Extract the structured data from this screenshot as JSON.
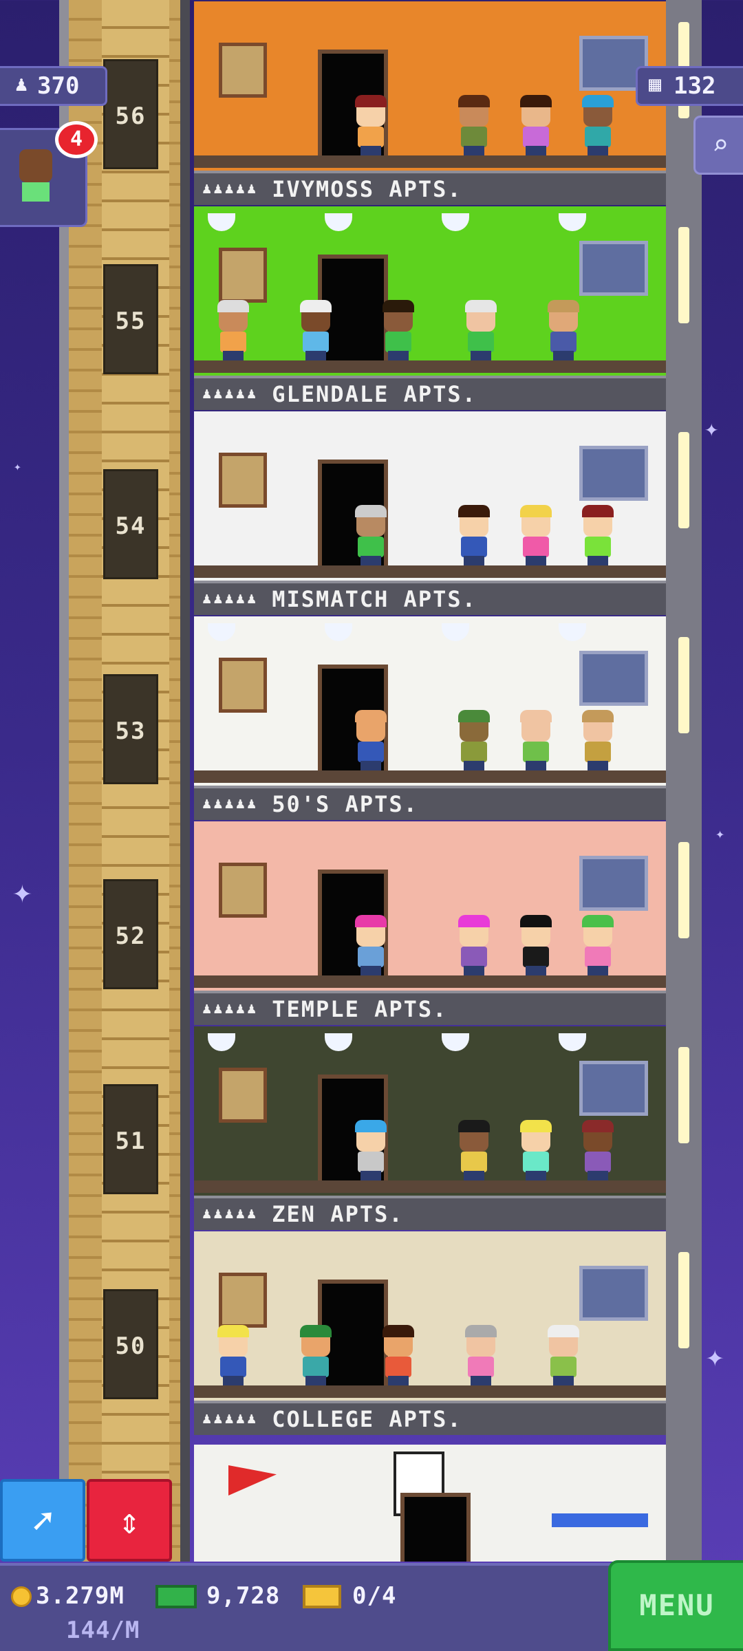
{
  "hud": {
    "population": "370",
    "floors_count": "132",
    "visitor_badge": "4",
    "icons": {
      "population": "person-icon",
      "floors": "building-icon",
      "search": "magnifier-icon"
    }
  },
  "floors": [
    {
      "number": "56",
      "name": "IVYMOSS APTS.",
      "wall": "#e8862a",
      "residents": [
        {
          "skin": "#f6d1a9",
          "hair": "#8a1f1f",
          "shirt": "#f1a24a"
        },
        {
          "skin": "#c98a5a",
          "hair": "#5a2a12",
          "shirt": "#6e8a3a"
        },
        {
          "skin": "#e9b78a",
          "hair": "#3a1a0a",
          "shirt": "#c86ad8"
        },
        {
          "skin": "#8a5a3a",
          "hair": "#2aa0d8",
          "shirt": "#30a8a8"
        }
      ]
    },
    {
      "number": "55",
      "name": "GLENDALE APTS.",
      "wall": "#5ed21e",
      "residents": [
        {
          "skin": "#c98a5a",
          "hair": "#ddd",
          "shirt": "#f1a24a"
        },
        {
          "skin": "#7a4a2a",
          "hair": "#eee",
          "shirt": "#5fb8e8"
        },
        {
          "skin": "#8a5a3a",
          "hair": "#2a1a0a",
          "shirt": "#3fc04a"
        },
        {
          "skin": "#f0c4a2",
          "hair": "#e6e6e6",
          "shirt": "#3fc04a"
        },
        {
          "skin": "#e0a878",
          "hair": "#c49a5a",
          "shirt": "#4a5aa8"
        }
      ]
    },
    {
      "number": "54",
      "name": "MISMATCH APTS.",
      "wall": "#f2f2f2",
      "residents": [
        {
          "skin": "#b88a62",
          "hair": "#ccc",
          "shirt": "#3fc04a"
        },
        {
          "skin": "#f6d1a9",
          "hair": "#3a1a0a",
          "shirt": "#3458b8"
        },
        {
          "skin": "#f6d1a9",
          "hair": "#f2d24a",
          "shirt": "#f05aa8"
        },
        {
          "skin": "#f6d1a9",
          "hair": "#8a1f1f",
          "shirt": "#7ae23a"
        }
      ]
    },
    {
      "number": "53",
      "name": "50'S APTS.",
      "wall": "#f4f4f0",
      "residents": [
        {
          "skin": "#e9a46a",
          "hair": "#e9a46a",
          "shirt": "#3458b8"
        },
        {
          "skin": "#8a6a3a",
          "hair": "#4a8a3a",
          "shirt": "#8a9a3a"
        },
        {
          "skin": "#f0c4a2",
          "hair": "#f0c4a2",
          "shirt": "#6fc04a"
        },
        {
          "skin": "#f0c4a2",
          "hair": "#c49a5a",
          "shirt": "#c4a040"
        }
      ]
    },
    {
      "number": "52",
      "name": "TEMPLE APTS.",
      "wall": "#f3b8a8",
      "residents": [
        {
          "skin": "#f6d1a9",
          "hair": "#e83aa8",
          "shirt": "#6aa0d8"
        },
        {
          "skin": "#f6d1a9",
          "hair": "#e83ad8",
          "shirt": "#8a5ab8"
        },
        {
          "skin": "#f6d1a9",
          "hair": "#111",
          "shirt": "#1a1a1a"
        },
        {
          "skin": "#f6d1a9",
          "hair": "#4ac04a",
          "shirt": "#f07ab8"
        }
      ]
    },
    {
      "number": "51",
      "name": "ZEN APTS.",
      "wall": "#3f4630",
      "residents": [
        {
          "skin": "#f6d1a9",
          "hair": "#3aa8e8",
          "shirt": "#c8c8c8"
        },
        {
          "skin": "#8a5a3a",
          "hair": "#1a1a1a",
          "shirt": "#e8c84a"
        },
        {
          "skin": "#f6d1a9",
          "hair": "#f2e24a",
          "shirt": "#6ae8c8"
        },
        {
          "skin": "#7a4a2a",
          "hair": "#8a2a2a",
          "shirt": "#8a5ab8"
        }
      ]
    },
    {
      "number": "50",
      "name": "COLLEGE APTS.",
      "wall": "#e6dcc0",
      "residents": [
        {
          "skin": "#f6d1a9",
          "hair": "#f2e24a",
          "shirt": "#3458b8"
        },
        {
          "skin": "#e9a46a",
          "hair": "#2a8a3a",
          "shirt": "#3aa8a8"
        },
        {
          "skin": "#e9a46a",
          "hair": "#3a1a0a",
          "shirt": "#e85a3a"
        },
        {
          "skin": "#f0c4a2",
          "hair": "#aaa",
          "shirt": "#f07ab8"
        },
        {
          "skin": "#f0c4a2",
          "hair": "#eee",
          "shirt": "#8ac04a"
        }
      ]
    }
  ],
  "bottom": {
    "coins": "3.279M",
    "rate": "144/M",
    "bux": "9,728",
    "tickets": "0/4",
    "menu_label": "MENU",
    "icons": {
      "coins": "coin-icon",
      "bux": "cash-icon",
      "tickets": "ticket-icon",
      "elevator": "elevator-arrows-icon",
      "build": "paint-brush-icon"
    }
  },
  "colors": {
    "menu": "#2fb84a",
    "elevator_button": "#e8243e",
    "build_button": "#3a9ef2",
    "hud": "#4c4a8a"
  }
}
